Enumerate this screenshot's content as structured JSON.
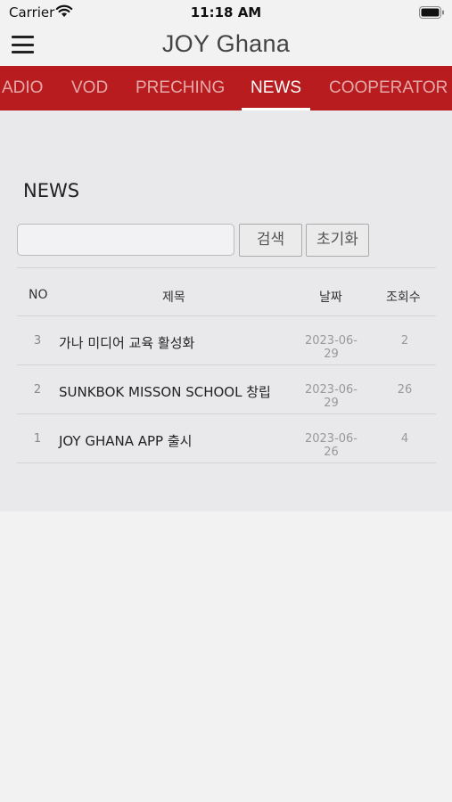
{
  "status_bar": {
    "carrier": "Carrier",
    "time": "11:18 AM"
  },
  "nav": {
    "title": "JOY Ghana",
    "menu_icon": "hamburger-menu-icon"
  },
  "tabs": [
    {
      "label": "ADIO"
    },
    {
      "label": "VOD"
    },
    {
      "label": "PRECHING"
    },
    {
      "label": "NEWS",
      "active": true
    },
    {
      "label": "COOPERATOR"
    }
  ],
  "accent_color": "#b81c1f",
  "section": {
    "title": "NEWS"
  },
  "search": {
    "placeholder": "",
    "value": "",
    "search_label": "검색",
    "reset_label": "초기화"
  },
  "table": {
    "headers": {
      "no": "NO",
      "title": "제목",
      "date": "날짜",
      "views": "조회수"
    },
    "rows": [
      {
        "no": "3",
        "title": "가나 미디어 교육 활성화",
        "date": "2023-06-29",
        "views": "2"
      },
      {
        "no": "2",
        "title": "SUNKBOK MISSON SCHOOL 창립",
        "date": "2023-06-29",
        "views": "26"
      },
      {
        "no": "1",
        "title": "JOY GHANA APP 출시",
        "date": "2023-06-26",
        "views": "4"
      }
    ]
  }
}
